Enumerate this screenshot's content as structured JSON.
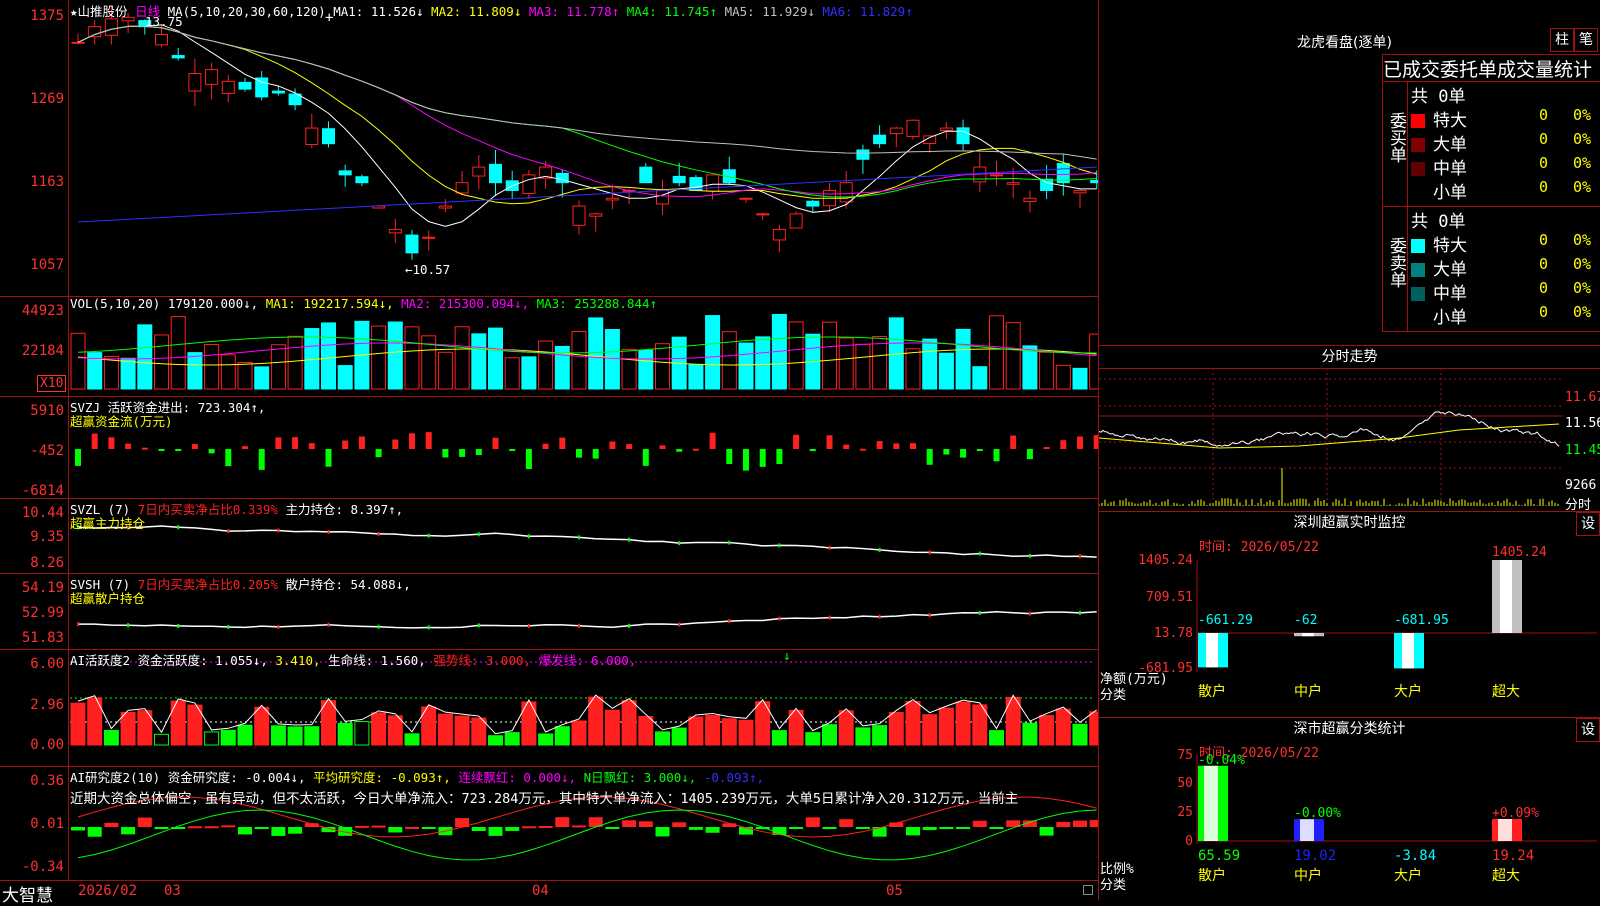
{
  "kline": {
    "star": "★",
    "stock_name": "山推股份",
    "period": "日线",
    "ma_header": "MA(5,10,20,30,60,120)",
    "ma_values": [
      {
        "text": "MA1: 11.526↓",
        "color": "#ffffff"
      },
      {
        "text": "MA2: 11.809↓",
        "color": "#ffff00"
      },
      {
        "text": "MA3: 11.778↑",
        "color": "#ff00ff"
      },
      {
        "text": "MA4: 11.745↑",
        "color": "#00ff00"
      },
      {
        "text": "MA5: 11.929↓",
        "color": "#c0c0c0"
      },
      {
        "text": "MA6: 11.829↑",
        "color": "#0000ff"
      }
    ],
    "y_ticks": [
      "1375",
      "1269",
      "1163",
      "1057"
    ],
    "high_marker": "13.75",
    "low_marker": "←10.57",
    "plus": "+"
  },
  "volume": {
    "header": "VOL(5,10,20)",
    "value": "179120.000↓,",
    "ma1": "MA1: 192217.594↓,",
    "ma2": "MA2: 215300.094↓,",
    "ma3": "MA3: 253288.844↑",
    "y_ticks": [
      "44923",
      "22184"
    ],
    "unit": "X10"
  },
  "svzj": {
    "header": "SVZJ",
    "label": "活跃资金进出: 723.304↑,",
    "sub": "超赢资金流(万元)",
    "y_ticks": [
      "5910",
      "-452",
      "-6814"
    ]
  },
  "svzl": {
    "header": "SVZL (7)",
    "label": "7日内买卖净占比0.339%",
    "hold": "主力持仓: 8.397↑,",
    "sub": "超赢主力持仓",
    "y_ticks": [
      "10.44",
      "9.35",
      "8.26"
    ]
  },
  "svsh": {
    "header": "SVSH (7)",
    "label": "7日内买卖净占比0.205%",
    "hold": "散户持仓: 54.088↓,",
    "sub": "超赢散户持仓",
    "y_ticks": [
      "54.19",
      "52.99",
      "51.83"
    ]
  },
  "ai_active": {
    "header": "AI活跃度2",
    "v1": "资金活跃度: 1.055↓,",
    "v2": "3.410,",
    "v3": "生命线: 1.560,",
    "v4": "强势线: 3.000,",
    "v5": "爆发线: 6.000,",
    "arrow": "↓",
    "y_ticks": [
      "6.00",
      "2.96",
      "0.00"
    ]
  },
  "ai_research": {
    "header": "AI研究度2(10)",
    "v1": "资金研究度: -0.004↓,",
    "v2": "平均研究度: -0.093↑,",
    "v3": "连续飘红: 0.000↓,",
    "v4": "N日飘红: 3.000↓,",
    "v5": "-0.093↑,",
    "comment": "近期大资金总体偏空，虽有异动，但不太活跃，今日大单净流入：723.284万元，其中特大单净流入：1405.239万元，大单5日累计净入20.312万元，当前主",
    "y_ticks": [
      "0.36",
      "0.01",
      "-0.34"
    ]
  },
  "timeline": {
    "brand": "大智慧",
    "year_month": "2026/02",
    "m3": "03",
    "m4": "04",
    "m5": "05"
  },
  "dragon": {
    "title": "龙虎看盘(逐单)",
    "btn1": "柱",
    "btn2": "笔",
    "section": "已成交委托单成交量统计",
    "buy_label": "委买单",
    "sell_label": "委卖单",
    "buy_total": "共 0单",
    "sell_total": "共 0单",
    "buy_rows": [
      {
        "label": "特大",
        "color": "#ff0000",
        "count": "0",
        "pct": "0%"
      },
      {
        "label": "大单",
        "color": "#800000",
        "count": "0",
        "pct": "0%"
      },
      {
        "label": "中单",
        "color": "#600000",
        "count": "0",
        "pct": "0%"
      },
      {
        "label": "小单",
        "color": "#000000",
        "count": "0",
        "pct": "0%"
      }
    ],
    "sell_rows": [
      {
        "label": "特大",
        "color": "#00ffff",
        "count": "0",
        "pct": "0%"
      },
      {
        "label": "大单",
        "color": "#008080",
        "count": "0",
        "pct": "0%"
      },
      {
        "label": "中单",
        "color": "#006060",
        "count": "0",
        "pct": "0%"
      },
      {
        "label": "小单",
        "color": "#000000",
        "count": "0",
        "pct": "0%"
      }
    ]
  },
  "intraday": {
    "title": "分时走势",
    "y_ticks": [
      "11.67",
      "11.56",
      "11.45"
    ],
    "vol": "9266",
    "unit": "分时"
  },
  "sz_monitor": {
    "title": "深圳超赢实时监控",
    "set": "设",
    "time": "时间: 2026/05/22",
    "y_ticks": [
      "1405.24",
      "709.51",
      "13.78",
      "-681.95"
    ],
    "ylabel1": "净额(万元)",
    "ylabel2": "分类",
    "categories": [
      "散户",
      "中户",
      "大户",
      "超大"
    ],
    "values": [
      "-661.29",
      "-62",
      "-681.95",
      "1405.24"
    ]
  },
  "sz_class": {
    "title": "深市超赢分类统计",
    "set": "设",
    "time": "时间: 2026/05/22",
    "y_ticks": [
      "75",
      "50",
      "25",
      "0"
    ],
    "ylabel1": "比例%",
    "ylabel2": "分类",
    "categories": [
      "散户",
      "中户",
      "大户",
      "超大"
    ],
    "top_labels": [
      "-0.04%",
      "-0.00%",
      "",
      "+0.09%"
    ],
    "bottom_values": [
      "65.59",
      "19.02",
      "-3.84",
      "19.24"
    ]
  }
}
